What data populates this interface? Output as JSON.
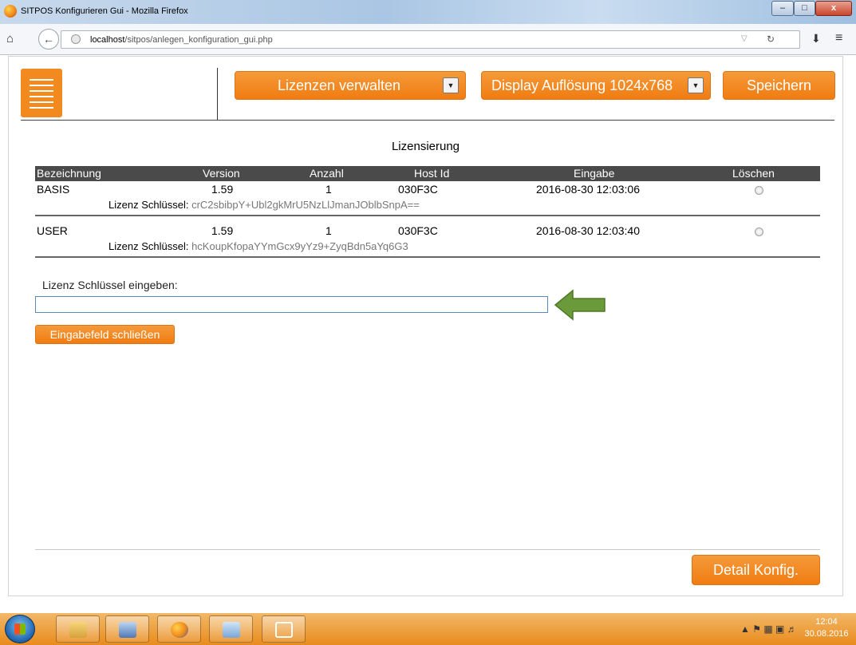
{
  "browser": {
    "window_title": "SITPOS Konfigurieren Gui - Mozilla Firefox",
    "url_host": "localhost",
    "url_path": "/sitpos/anlegen_konfiguration_gui.php",
    "min_symbol": "–",
    "max_symbol": "□",
    "close_symbol": "x"
  },
  "header": {
    "license_dropdown_label": "Lizenzen verwalten",
    "resolution_dropdown_label": "Display Auflösung 1024x768",
    "save_label": "Speichern"
  },
  "licenses": {
    "title": "Lizensierung",
    "columns": [
      "Bezeichnung",
      "Version",
      "Anzahl",
      "Host Id",
      "Eingabe",
      "Löschen"
    ],
    "key_label": "Lizenz Schlüssel:",
    "rows": [
      {
        "name": "BASIS",
        "version": "1.59",
        "count": "1",
        "host_id": "030F3C",
        "entered": "2016-08-30 12:03:06",
        "key": "crC2sbibpY+Ubl2gkMrU5NzLlJmanJOblbSnpA=="
      },
      {
        "name": "USER",
        "version": "1.59",
        "count": "1",
        "host_id": "030F3C",
        "entered": "2016-08-30 12:03:40",
        "key": "hcKoupKfopaYYmGcx9yYz9+ZyqBdn5aYq6G3"
      }
    ]
  },
  "entry": {
    "label": "Lizenz Schlüssel eingeben:",
    "value": "",
    "close_button": "Eingabefeld schließen"
  },
  "footer": {
    "detail_button": "Detail Konfig."
  },
  "taskbar": {
    "time": "12:04",
    "date": "30.08.2016"
  },
  "colors": {
    "accent_orange": "#f07c11",
    "table_header": "#4a4a4a",
    "arrow_green": "#6a9a3a"
  }
}
